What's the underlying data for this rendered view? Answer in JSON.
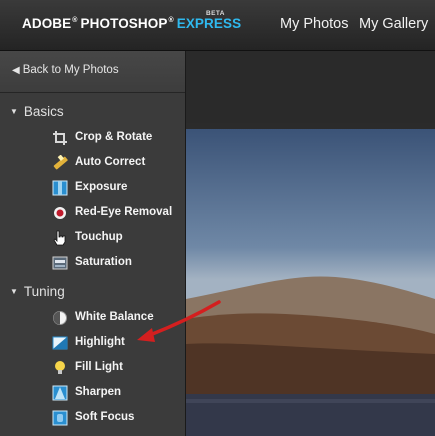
{
  "header": {
    "brand_adobe": "ADOBE",
    "brand_photoshop": "PHOTOSHOP",
    "brand_express": "EXPRESS",
    "beta_badge": "BETA",
    "reg_mark": "®",
    "nav": [
      {
        "label": "My Photos"
      },
      {
        "label": "My Gallery"
      }
    ]
  },
  "sidebar": {
    "back_label": "Back to My Photos",
    "sections": [
      {
        "title": "Basics",
        "tools": [
          {
            "label": "Crop & Rotate",
            "icon": "crop-icon"
          },
          {
            "label": "Auto Correct",
            "icon": "magic-wand-icon"
          },
          {
            "label": "Exposure",
            "icon": "exposure-icon"
          },
          {
            "label": "Red-Eye Removal",
            "icon": "red-eye-icon"
          },
          {
            "label": "Touchup",
            "icon": "hand-cursor-icon"
          },
          {
            "label": "Saturation",
            "icon": "saturation-icon"
          }
        ]
      },
      {
        "title": "Tuning",
        "tools": [
          {
            "label": "White Balance",
            "icon": "white-balance-icon"
          },
          {
            "label": "Highlight",
            "icon": "highlight-icon"
          },
          {
            "label": "Fill Light",
            "icon": "light-bulb-icon"
          },
          {
            "label": "Sharpen",
            "icon": "sharpen-icon"
          },
          {
            "label": "Soft Focus",
            "icon": "soft-focus-icon"
          }
        ]
      }
    ]
  },
  "colors": {
    "express_blue": "#2fb9ee",
    "annotation_arrow": "#d41f1f"
  }
}
